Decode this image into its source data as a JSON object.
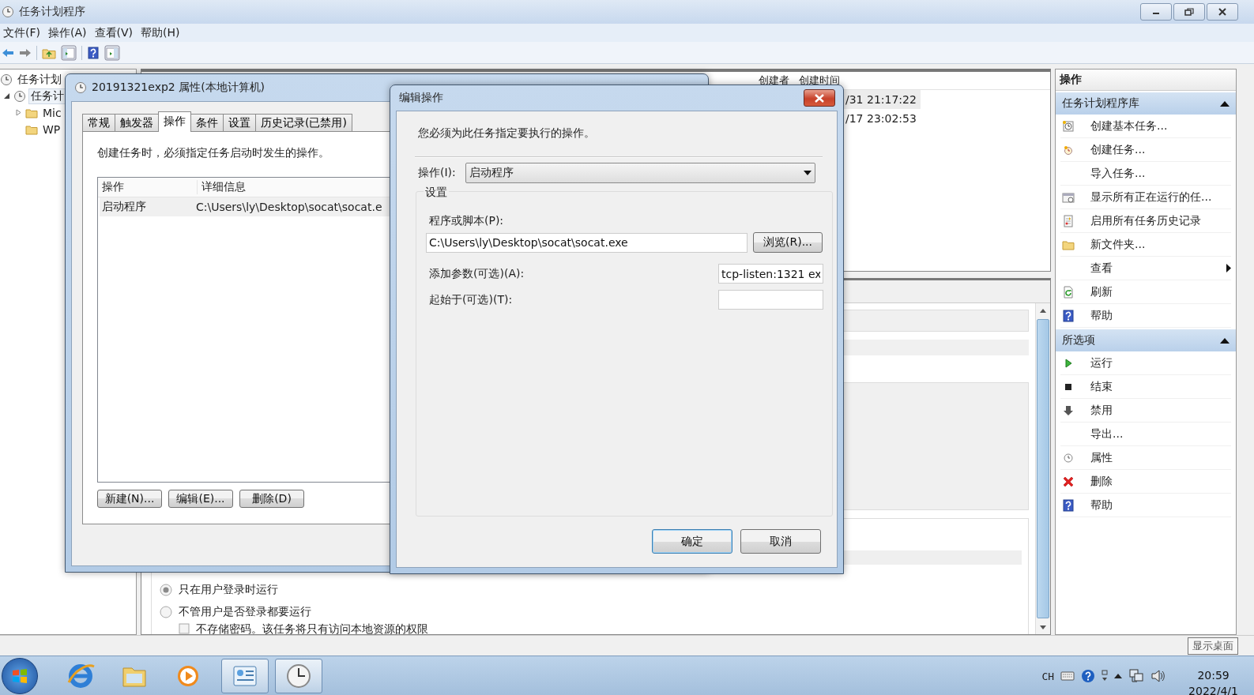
{
  "window": {
    "title": "任务计划程序"
  },
  "menu": [
    "文件(F)",
    "操作(A)",
    "查看(V)",
    "帮助(H)"
  ],
  "tree": [
    {
      "label": "任务计划",
      "selected": false
    },
    {
      "label": "任务计",
      "selected": true,
      "expanded": true,
      "children": [
        {
          "label": "Mic",
          "selected": false,
          "expanded": false
        },
        {
          "label": "WP",
          "selected": false
        }
      ]
    }
  ],
  "task_list": {
    "columns": [
      "创建者",
      "创建时间"
    ],
    "rows": [
      {
        "column_2": "/31 21:17:22",
        "selected": true
      },
      {
        "column_2": "/17 23:02:53",
        "selected": false
      }
    ]
  },
  "details": {
    "options": [
      {
        "kind": "radio",
        "label": "只在用户登录时运行",
        "selected": true
      },
      {
        "kind": "radio",
        "label": "不管用户是否登录都要运行",
        "selected": false
      },
      {
        "kind": "checkbox",
        "label": "不存储密码。该任务将只有访问本地资源的权限",
        "checked": false
      }
    ]
  },
  "actions_pane": {
    "title": "操作",
    "sections": [
      {
        "title": "任务计划程序库",
        "expanded": true,
        "items": [
          {
            "label": "创建基本任务...",
            "kind": "wizard"
          },
          {
            "label": "创建任务...",
            "kind": "create"
          },
          {
            "label": "导入任务...",
            "kind": "plain"
          },
          {
            "label": "显示所有正在运行的任...",
            "kind": "running"
          },
          {
            "label": "启用所有任务历史记录",
            "kind": "history"
          },
          {
            "label": "新文件夹...",
            "kind": "folder"
          },
          {
            "label": "查看",
            "kind": "submenu"
          },
          {
            "label": "刷新",
            "kind": "refresh"
          },
          {
            "label": "帮助",
            "kind": "help"
          }
        ]
      },
      {
        "title": "所选项",
        "expanded": true,
        "items": [
          {
            "label": "运行",
            "kind": "run"
          },
          {
            "label": "结束",
            "kind": "stop"
          },
          {
            "label": "禁用",
            "kind": "disable"
          },
          {
            "label": "导出...",
            "kind": "plain"
          },
          {
            "label": "属性",
            "kind": "properties"
          },
          {
            "label": "删除",
            "kind": "delete"
          },
          {
            "label": "帮助",
            "kind": "help"
          }
        ]
      }
    ]
  },
  "tooltip": "显示桌面",
  "properties_dialog": {
    "title": "20191321exp2 属性(本地计算机)",
    "tabs": [
      {
        "label": "常规",
        "selected": false
      },
      {
        "label": "触发器",
        "selected": false
      },
      {
        "label": "操作",
        "selected": true
      },
      {
        "label": "条件",
        "selected": false
      },
      {
        "label": "设置",
        "selected": false
      },
      {
        "label": "历史记录(已禁用)",
        "selected": false
      }
    ],
    "description": "创建任务时，必须指定任务启动时发生的操作。",
    "actions_table": {
      "columns": [
        "操作",
        "详细信息"
      ],
      "rows": [
        {
          "action": "启动程序",
          "details": "C:\\Users\\ly\\Desktop\\socat\\socat.e",
          "selected": true
        }
      ]
    },
    "buttons": [
      "新建(N)...",
      "编辑(E)...",
      "删除(D)"
    ]
  },
  "edit_dialog": {
    "title": "编辑操作",
    "description": "您必须为此任务指定要执行的操作。",
    "action_label": "操作(I):",
    "action_value": "启动程序",
    "settings_label": "设置",
    "program_label": "程序或脚本(P):",
    "program_value": "C:\\Users\\ly\\Desktop\\socat\\socat.exe",
    "browse_button": "浏览(R)...",
    "arguments_label": "添加参数(可选)(A):",
    "arguments_value": "tcp-listen:1321 ex",
    "start_in_label": "起始于(可选)(T):",
    "buttons": [
      {
        "label": "确定",
        "default": true
      },
      {
        "label": "取消",
        "default": false
      }
    ]
  },
  "taskbar": {
    "apps": [
      {
        "kind": "browser",
        "active": false
      },
      {
        "kind": "folder",
        "active": false
      },
      {
        "kind": "media",
        "active": false
      },
      {
        "kind": "panel",
        "active": true
      },
      {
        "kind": "clock",
        "active": true
      }
    ],
    "language": "CH",
    "time": "20:59",
    "date": "2022/4/1"
  }
}
